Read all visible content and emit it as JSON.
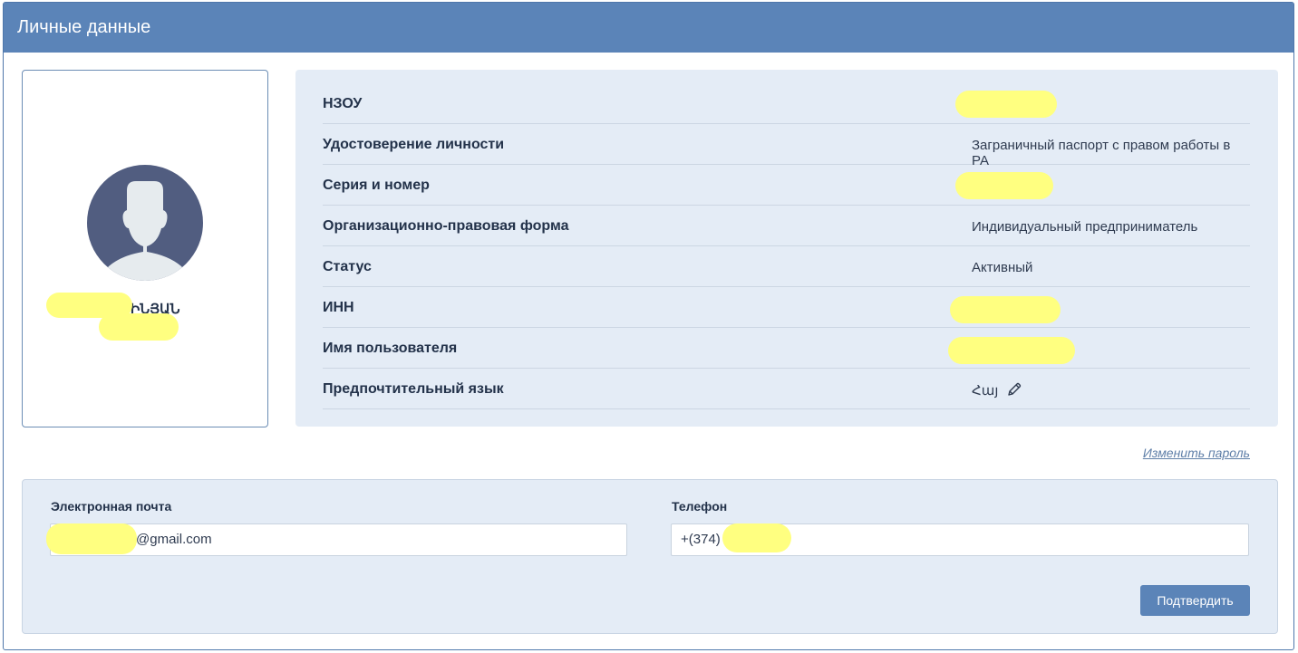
{
  "header": {
    "title": "Личные данные"
  },
  "profile": {
    "name_fragment": "ԱՍԻՆՅԱՆ",
    "avatar_icon": "user-silhouette-icon"
  },
  "info": {
    "rows": [
      {
        "label": "НЗОУ",
        "value": ""
      },
      {
        "label": "Удостоверение личности",
        "value": "Заграничный паспорт с правом работы в РА"
      },
      {
        "label": "Серия и номер",
        "value": ""
      },
      {
        "label": "Организационно-правовая форма",
        "value": "Индивидуальный предприниматель"
      },
      {
        "label": "Статус",
        "value": "Активный"
      },
      {
        "label": "ИНН",
        "value": ""
      },
      {
        "label": "Имя пользователя",
        "value": ""
      },
      {
        "label": "Предпочтительный язык",
        "value": "Հայ"
      }
    ],
    "edit_icon": "pencil-icon"
  },
  "links": {
    "change_password": "Изменить пароль"
  },
  "contact": {
    "email_label": "Электронная почта",
    "email_value": "@gmail.com",
    "phone_label": "Телефон",
    "phone_value": "+(374)",
    "submit_label": "Подтвердить"
  },
  "colors": {
    "header_bg": "#5b84b8",
    "card_bg": "#e4ecf6",
    "avatar_bg": "#515d80",
    "redaction": "#ffff80"
  }
}
